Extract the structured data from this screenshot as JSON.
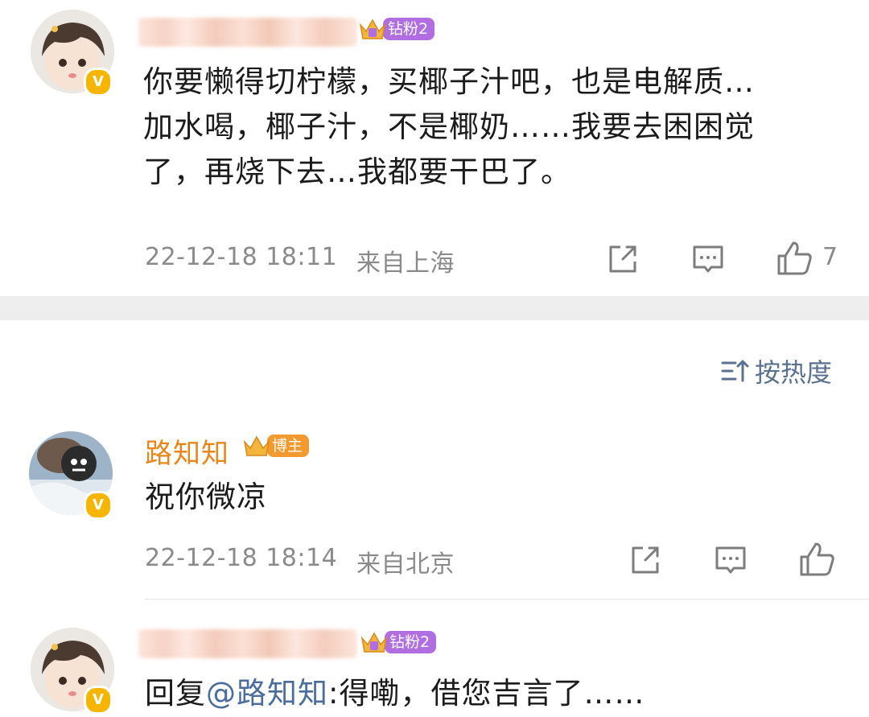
{
  "comments": [
    {
      "text_lines": [
        "你要懒得切柠檬，买椰子汁吧，也是电解质…",
        "加水喝，椰子汁，不是椰奶……我要去困困觉",
        "了，再烧下去…我都要干巴了。"
      ],
      "badge": "钻粉2",
      "timestamp": "22-12-18 18:11",
      "location": "来自上海",
      "likes": "7"
    }
  ],
  "sort": {
    "label": "按热度"
  },
  "replies": [
    {
      "name": "路知知",
      "badge": "博主",
      "text": "祝你微凉",
      "timestamp": "22-12-18 18:14",
      "location": "来自北京"
    },
    {
      "badge": "钻粉2",
      "prefix": "回复",
      "mention": "@路知知",
      "text": ":得嘞，借您吉言了……"
    }
  ],
  "verified_mark": "V",
  "colors": {
    "accent_orange": "#e8861a",
    "badge_purple": "#b06ee0",
    "badge_orange": "#f29a2e",
    "link_blue": "#4a6d9c",
    "meta_gray": "#8a8a8a"
  },
  "icons": [
    "share-icon",
    "comment-icon",
    "like-icon",
    "sort-icon",
    "crown-icon"
  ]
}
